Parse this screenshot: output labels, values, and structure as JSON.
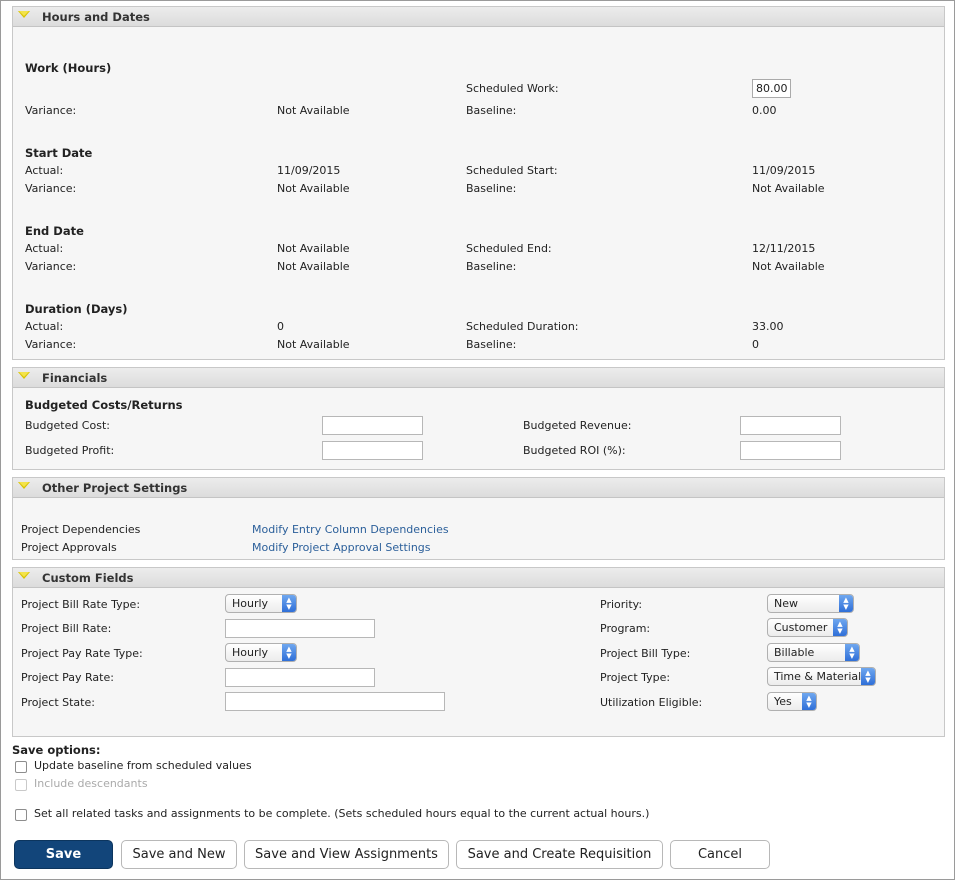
{
  "hours_dates": {
    "header": "Hours and Dates",
    "work_title": "Work (Hours)",
    "scheduled_work_label": "Scheduled Work:",
    "scheduled_work_value": "80.00",
    "work_variance_label": "Variance:",
    "work_variance_value": "Not Available",
    "work_baseline_label": "Baseline:",
    "work_baseline_value": "0.00",
    "start_title": "Start Date",
    "start_actual_label": "Actual:",
    "start_actual_value": "11/09/2015",
    "scheduled_start_label": "Scheduled Start:",
    "scheduled_start_value": "11/09/2015",
    "start_variance_label": "Variance:",
    "start_variance_value": "Not Available",
    "start_baseline_label": "Baseline:",
    "start_baseline_value": "Not Available",
    "end_title": "End Date",
    "end_actual_label": "Actual:",
    "end_actual_value": "Not Available",
    "scheduled_end_label": "Scheduled End:",
    "scheduled_end_value": "12/11/2015",
    "end_variance_label": "Variance:",
    "end_variance_value": "Not Available",
    "end_baseline_label": "Baseline:",
    "end_baseline_value": "Not Available",
    "duration_title": "Duration (Days)",
    "duration_actual_label": "Actual:",
    "duration_actual_value": "0",
    "scheduled_duration_label": "Scheduled Duration:",
    "scheduled_duration_value": "33.00",
    "duration_variance_label": "Variance:",
    "duration_variance_value": "Not Available",
    "duration_baseline_label": "Baseline:",
    "duration_baseline_value": "0"
  },
  "financials": {
    "header": "Financials",
    "subtitle": "Budgeted Costs/Returns",
    "budgeted_cost_label": "Budgeted Cost:",
    "budgeted_revenue_label": "Budgeted Revenue:",
    "budgeted_profit_label": "Budgeted Profit:",
    "budgeted_roi_label": "Budgeted ROI (%):"
  },
  "other_settings": {
    "header": "Other Project Settings",
    "dependencies_label": "Project Dependencies",
    "dependencies_link": "Modify Entry Column Dependencies",
    "approvals_label": "Project Approvals",
    "approvals_link": "Modify Project Approval Settings"
  },
  "custom_fields": {
    "header": "Custom Fields",
    "bill_rate_type_label": "Project Bill Rate Type:",
    "bill_rate_type_value": "Hourly",
    "bill_rate_label": "Project Bill Rate:",
    "pay_rate_type_label": "Project Pay Rate Type:",
    "pay_rate_type_value": "Hourly",
    "pay_rate_label": "Project Pay Rate:",
    "state_label": "Project State:",
    "priority_label": "Priority:",
    "priority_value": "New",
    "program_label": "Program:",
    "program_value": "Customer",
    "bill_type_label": "Project Bill Type:",
    "bill_type_value": "Billable",
    "project_type_label": "Project Type:",
    "project_type_value": "Time & Material",
    "utilization_label": "Utilization Eligible:",
    "utilization_value": "Yes"
  },
  "save_options": {
    "title": "Save options:",
    "update_baseline": "Update baseline from scheduled values",
    "include_descendants": "Include descendants",
    "set_complete": "Set all related tasks and assignments to be complete. (Sets scheduled hours equal to the current actual hours.)"
  },
  "buttons": {
    "save": "Save",
    "save_new": "Save and New",
    "save_view": "Save and View Assignments",
    "save_requisition": "Save and Create Requisition",
    "cancel": "Cancel"
  }
}
